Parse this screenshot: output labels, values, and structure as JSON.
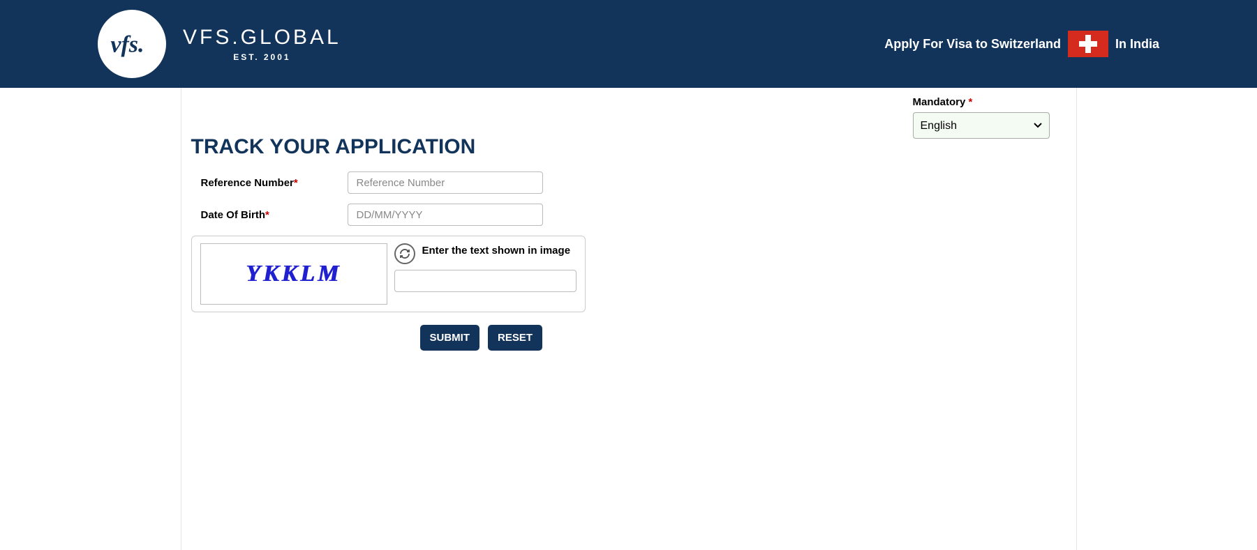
{
  "header": {
    "brand_main": "VFS.GLOBAL",
    "brand_sub": "EST. 2001",
    "apply_prefix": "Apply For Visa to Switzerland",
    "apply_suffix": "In India"
  },
  "mandatory_label": "Mandatory",
  "language": {
    "selected": "English",
    "options": [
      "English"
    ]
  },
  "page_title": "TRACK YOUR APPLICATION",
  "form": {
    "reference": {
      "label": "Reference Number",
      "placeholder": "Reference Number",
      "value": ""
    },
    "dob": {
      "label": "Date Of Birth",
      "placeholder": "DD/MM/YYYY",
      "value": ""
    }
  },
  "captcha": {
    "text": "YKKLM",
    "instruction": "Enter the text shown in image",
    "value": ""
  },
  "buttons": {
    "submit": "SUBMIT",
    "reset": "RESET"
  },
  "colors": {
    "primary": "#13345a",
    "flag_red": "#d52b1e",
    "required": "#cc0000"
  }
}
